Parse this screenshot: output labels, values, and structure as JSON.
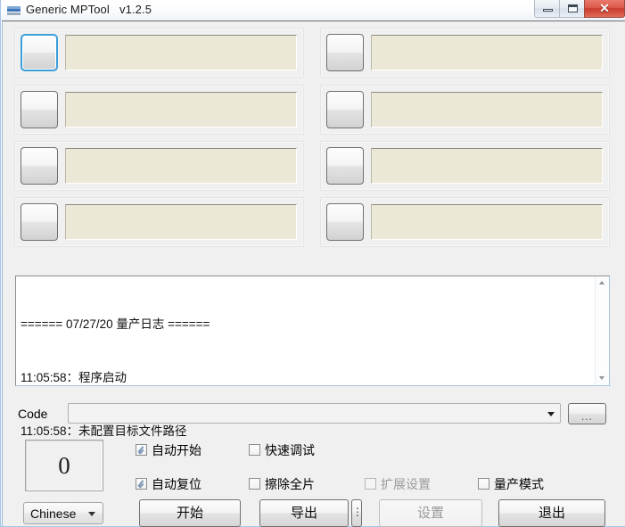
{
  "window": {
    "title": "Generic MPTool   v1.2.5",
    "app_name": "Generic MPTool",
    "version": "v1.2.5",
    "icon": "app-bars-icon",
    "controls": {
      "minimize": "minimize-icon",
      "maximize": "maximize-icon",
      "close": "✕"
    }
  },
  "slots": [
    {
      "index": 1,
      "button_label": "",
      "field_value": "",
      "focused": true
    },
    {
      "index": 2,
      "button_label": "",
      "field_value": "",
      "focused": false
    },
    {
      "index": 3,
      "button_label": "",
      "field_value": "",
      "focused": false
    },
    {
      "index": 4,
      "button_label": "",
      "field_value": "",
      "focused": false
    },
    {
      "index": 5,
      "button_label": "",
      "field_value": "",
      "focused": false
    },
    {
      "index": 6,
      "button_label": "",
      "field_value": "",
      "focused": false
    },
    {
      "index": 7,
      "button_label": "",
      "field_value": "",
      "focused": false
    },
    {
      "index": 8,
      "button_label": "",
      "field_value": "",
      "focused": false
    }
  ],
  "log": {
    "lines": [
      "====== 07/27/20 量产日志 ======",
      "11:05:58：程序启动",
      "11:05:58：未配置目标文件路径"
    ],
    "scroll": {
      "up_icon": "scroll-up-icon",
      "down_icon": "scroll-down-icon"
    }
  },
  "code_row": {
    "label": "Code",
    "value": "",
    "placeholder": "",
    "dropdown_icon": "chevron-down-icon",
    "browse_label": "..."
  },
  "counter": {
    "value": "0"
  },
  "options": [
    {
      "id": "auto-start",
      "label": "自动开始",
      "checked": true,
      "disabled": false
    },
    {
      "id": "quick-debug",
      "label": "快速调试",
      "checked": false,
      "disabled": false
    },
    {
      "id": "auto-reset",
      "label": "自动复位",
      "checked": true,
      "disabled": false
    },
    {
      "id": "erase-all",
      "label": "擦除全片",
      "checked": false,
      "disabled": false
    },
    {
      "id": "ext-settings",
      "label": "扩展设置",
      "checked": false,
      "disabled": true
    },
    {
      "id": "mp-mode",
      "label": "量产模式",
      "checked": false,
      "disabled": false
    }
  ],
  "bottom_bar": {
    "language": {
      "value": "Chinese",
      "dropdown_icon": "chevron-down-icon"
    },
    "start_label": "开始",
    "export_label": "导出",
    "more_label": "⋮",
    "settings_label": "设置",
    "settings_disabled": true,
    "exit_label": "退出"
  },
  "colors": {
    "field_beige": "#EBE8D7",
    "focus_blue": "#3C9FD8",
    "close_red": "#C93B2D",
    "window_border": "#A7C6E8",
    "client_bg": "#F0F0F0"
  }
}
